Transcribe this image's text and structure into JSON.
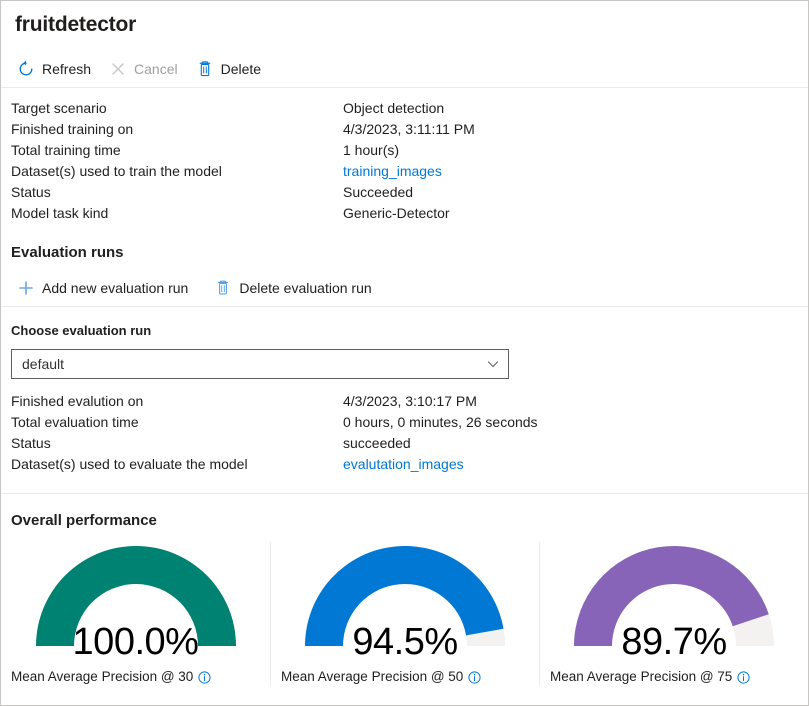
{
  "page_title": "fruitdetector",
  "colors": {
    "accent_blue": "#0078d4",
    "gauge_teal": "#008272",
    "gauge_blue": "#0078d4",
    "gauge_purple": "#8764b8",
    "gauge_track": "#f3f2f1",
    "disabled_text": "#a19f9d",
    "divider": "#edebe9"
  },
  "command_bar": {
    "refresh": {
      "label": "Refresh",
      "icon": "refresh-icon",
      "disabled": false
    },
    "cancel": {
      "label": "Cancel",
      "icon": "cancel-icon",
      "disabled": true
    },
    "delete": {
      "label": "Delete",
      "icon": "delete-icon",
      "disabled": false
    }
  },
  "model_properties": [
    {
      "key": "Target scenario",
      "value": "Object detection",
      "link": false
    },
    {
      "key": "Finished training on",
      "value": "4/3/2023, 3:11:11 PM",
      "link": false
    },
    {
      "key": "Total training time",
      "value": "1 hour(s)",
      "link": false
    },
    {
      "key": "Dataset(s) used to train the model",
      "value": "training_images",
      "link": true
    },
    {
      "key": "Status",
      "value": "Succeeded",
      "link": false
    },
    {
      "key": "Model task kind",
      "value": "Generic-Detector",
      "link": false
    }
  ],
  "evaluation_runs": {
    "heading": "Evaluation runs",
    "add_button": {
      "label": "Add new evaluation run",
      "icon": "plus-icon"
    },
    "delete_button": {
      "label": "Delete evaluation run",
      "icon": "delete-icon"
    }
  },
  "choose_run": {
    "label": "Choose evaluation run",
    "selected": "default",
    "placeholder": "default",
    "options": [
      "default"
    ],
    "caret_icon": "chevron-down-icon"
  },
  "evaluation_properties": [
    {
      "key": "Finished evalution on",
      "value": "4/3/2023, 3:10:17 PM",
      "link": false
    },
    {
      "key": "Total evaluation time",
      "value": "0 hours, 0 minutes, 26 seconds",
      "link": false
    },
    {
      "key": "Status",
      "value": "succeeded",
      "link": false
    },
    {
      "key": "Dataset(s) used to evaluate the model",
      "value": "evalutation_images",
      "link": true
    }
  ],
  "overall_performance": {
    "heading": "Overall performance",
    "gauges": [
      {
        "value_label": "100.0%",
        "percent": 100.0,
        "caption": "Mean Average Precision @ 30",
        "color": "#008272",
        "track": "#f3f2f1",
        "info_icon": "info-icon"
      },
      {
        "value_label": "94.5%",
        "percent": 94.5,
        "caption": "Mean Average Precision @ 50",
        "color": "#0078d4",
        "track": "#f3f2f1",
        "info_icon": "info-icon"
      },
      {
        "value_label": "89.7%",
        "percent": 89.7,
        "caption": "Mean Average Precision @ 75",
        "color": "#8764b8",
        "track": "#f3f2f1",
        "info_icon": "info-icon"
      }
    ]
  }
}
